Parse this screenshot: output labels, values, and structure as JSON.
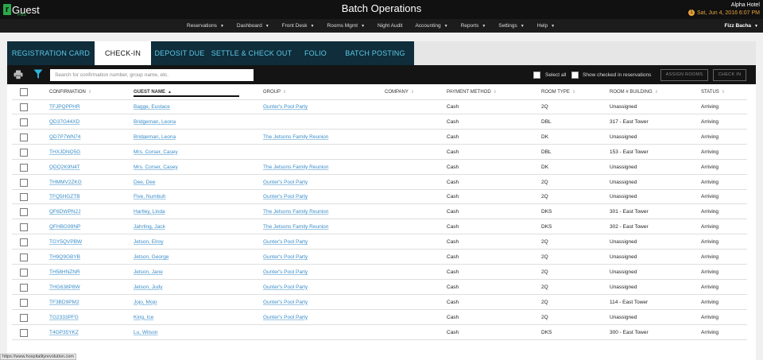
{
  "app": {
    "logo_mark": "r",
    "logo_text": "Guest",
    "logo_sub": "PMS",
    "title": "Batch Operations",
    "hotel_name": "Alpha Hotel",
    "alert_count": "1",
    "datetime": "Sat, Jun 4, 2016 6:07 PM"
  },
  "nav": {
    "items": [
      "Reservations",
      "Dashboard",
      "Front Desk",
      "Rooms Mgmt",
      "Night Audit",
      "Accounting",
      "Reports",
      "Settings",
      "Help"
    ],
    "has_caret": [
      true,
      true,
      true,
      true,
      false,
      true,
      true,
      true,
      true
    ],
    "user": "Fizz Bacha"
  },
  "tabs": [
    "REGISTRATION CARD",
    "CHECK-IN",
    "DEPOSIT DUE",
    "SETTLE & CHECK OUT",
    "FOLIO",
    "BATCH POSTING"
  ],
  "active_tab": "CHECK-IN",
  "toolbar": {
    "search_placeholder": "Search for confirmation number, group name, etc.",
    "select_all": "Select all",
    "show_checked": "Show checked in reservations",
    "assign_rooms": "ASSIGN ROOMS",
    "check_in": "CHECK IN"
  },
  "table": {
    "columns": [
      "CONFIRMATION",
      "GUEST NAME",
      "GROUP",
      "COMPANY",
      "PAYMENT METHOD",
      "ROOM TYPE",
      "ROOM # BUILDING",
      "STATUS"
    ],
    "sorted_column": "GUEST NAME",
    "rows": [
      [
        "TFJPQPPHR",
        "Bagge, Eustace",
        "Gunter's Pool Party",
        "",
        "Cash",
        "2Q",
        "Unassigned",
        "Arriving"
      ],
      [
        "QD37G44XD",
        "Bridgeman, Leona",
        "",
        "",
        "Cash",
        "DBL",
        "317 - East Tower",
        "Arriving"
      ],
      [
        "QD7P7WN74",
        "Bridgeman, Leona",
        "The Jetsons Family Reunion",
        "",
        "Cash",
        "DK",
        "Unassigned",
        "Arriving"
      ],
      [
        "THXJDNQ5G",
        "Mrs. Corser, Casey",
        "",
        "",
        "Cash",
        "DBL",
        "153 - East Tower",
        "Arriving"
      ],
      [
        "QDQ2K9N4T",
        "Mrs. Corser, Casey",
        "The Jetsons Family Reunion",
        "",
        "Cash",
        "DK",
        "Unassigned",
        "Arriving"
      ],
      [
        "THMMV2ZKG",
        "Dee, Dee",
        "Gunter's Pool Party",
        "",
        "Cash",
        "2Q",
        "Unassigned",
        "Arriving"
      ],
      [
        "TFQ5HGZTB",
        "Five, Numbuh",
        "Gunter's Pool Party",
        "",
        "Cash",
        "2Q",
        "Unassigned",
        "Arriving"
      ],
      [
        "QF6DWPN2J",
        "Hartley, Linda",
        "The Jetsons Family Reunion",
        "",
        "Cash",
        "DKS",
        "301 - East Tower",
        "Arriving"
      ],
      [
        "QFHBG99NP",
        "Jahrling, Jack",
        "The Jetsons Family Reunion",
        "",
        "Cash",
        "DKS",
        "302 - East Tower",
        "Arriving"
      ],
      [
        "TGY5QVPBW",
        "Jetson, Elroy",
        "Gunter's Pool Party",
        "",
        "Cash",
        "2Q",
        "Unassigned",
        "Arriving"
      ],
      [
        "TH9Q9GBYB",
        "Jetson, George",
        "Gunter's Pool Party",
        "",
        "Cash",
        "2Q",
        "Unassigned",
        "Arriving"
      ],
      [
        "TH58HNZNR",
        "Jetson, Jane",
        "Gunter's Pool Party",
        "",
        "Cash",
        "2Q",
        "Unassigned",
        "Arriving"
      ],
      [
        "THG638P8W",
        "Jetson, Judy",
        "Gunter's Pool Party",
        "",
        "Cash",
        "2Q",
        "Unassigned",
        "Arriving"
      ],
      [
        "TF3BD9PM2",
        "Jojo, Mojo",
        "Gunter's Pool Party",
        "",
        "Cash",
        "2Q",
        "114 - East Tower",
        "Arriving"
      ],
      [
        "TG2333PFG",
        "King, Ice",
        "Gunter's Pool Party",
        "",
        "Cash",
        "2Q",
        "Unassigned",
        "Arriving"
      ],
      [
        "T4GP35YKZ",
        "Lu, Wilson",
        "",
        "",
        "Cash",
        "DKS",
        "300 - East Tower",
        "Arriving"
      ]
    ]
  },
  "status_bar_url": "https://www.hospitalityrevolution.com"
}
